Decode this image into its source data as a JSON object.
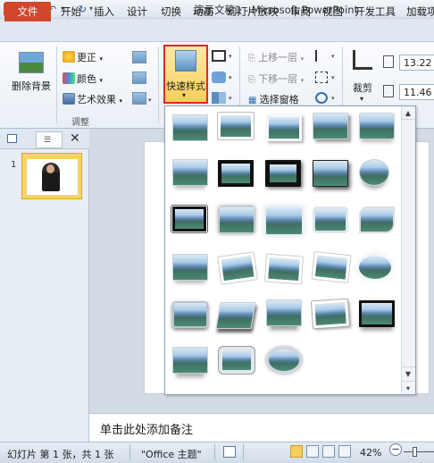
{
  "window": {
    "app_icon": "P",
    "title": "演示文稿1 - Microsoft PowerPoint",
    "qat": {
      "undo_icon": "undo-arrow",
      "redo_icon": "redo-arrow"
    }
  },
  "tabs": [
    "文件",
    "开始",
    "插入",
    "设计",
    "切换",
    "动画",
    "幻灯片放映",
    "审阅",
    "视图",
    "开发工具",
    "加载项"
  ],
  "ribbon": {
    "remove_background": "删除背景",
    "corrections": "更正",
    "color": "颜色",
    "artistic_effects": "艺术效果",
    "quick_styles": "快速样式",
    "bring_forward": "上移一层",
    "send_backward": "下移一层",
    "selection_pane": "选择窗格",
    "crop": "裁剪",
    "height_value": "13.22",
    "width_value": "11.46",
    "adjust_group": "调整"
  },
  "left_panel": {
    "slide_number": "1",
    "close_icon": "✕"
  },
  "notes_placeholder": "单击此处添加备注",
  "status": {
    "slide_info": "幻灯片 第 1 张，共 1 张",
    "theme": "\"Office 主题\"",
    "zoom": "42%",
    "zoom_minus": "−"
  },
  "gallery": {
    "name": "picture-styles",
    "rows": 6,
    "items_visible": 28
  },
  "colors": {
    "file_tab": "#d2472b",
    "highlight_border": "#e0262b",
    "selected_button": "#f8cf5a"
  }
}
